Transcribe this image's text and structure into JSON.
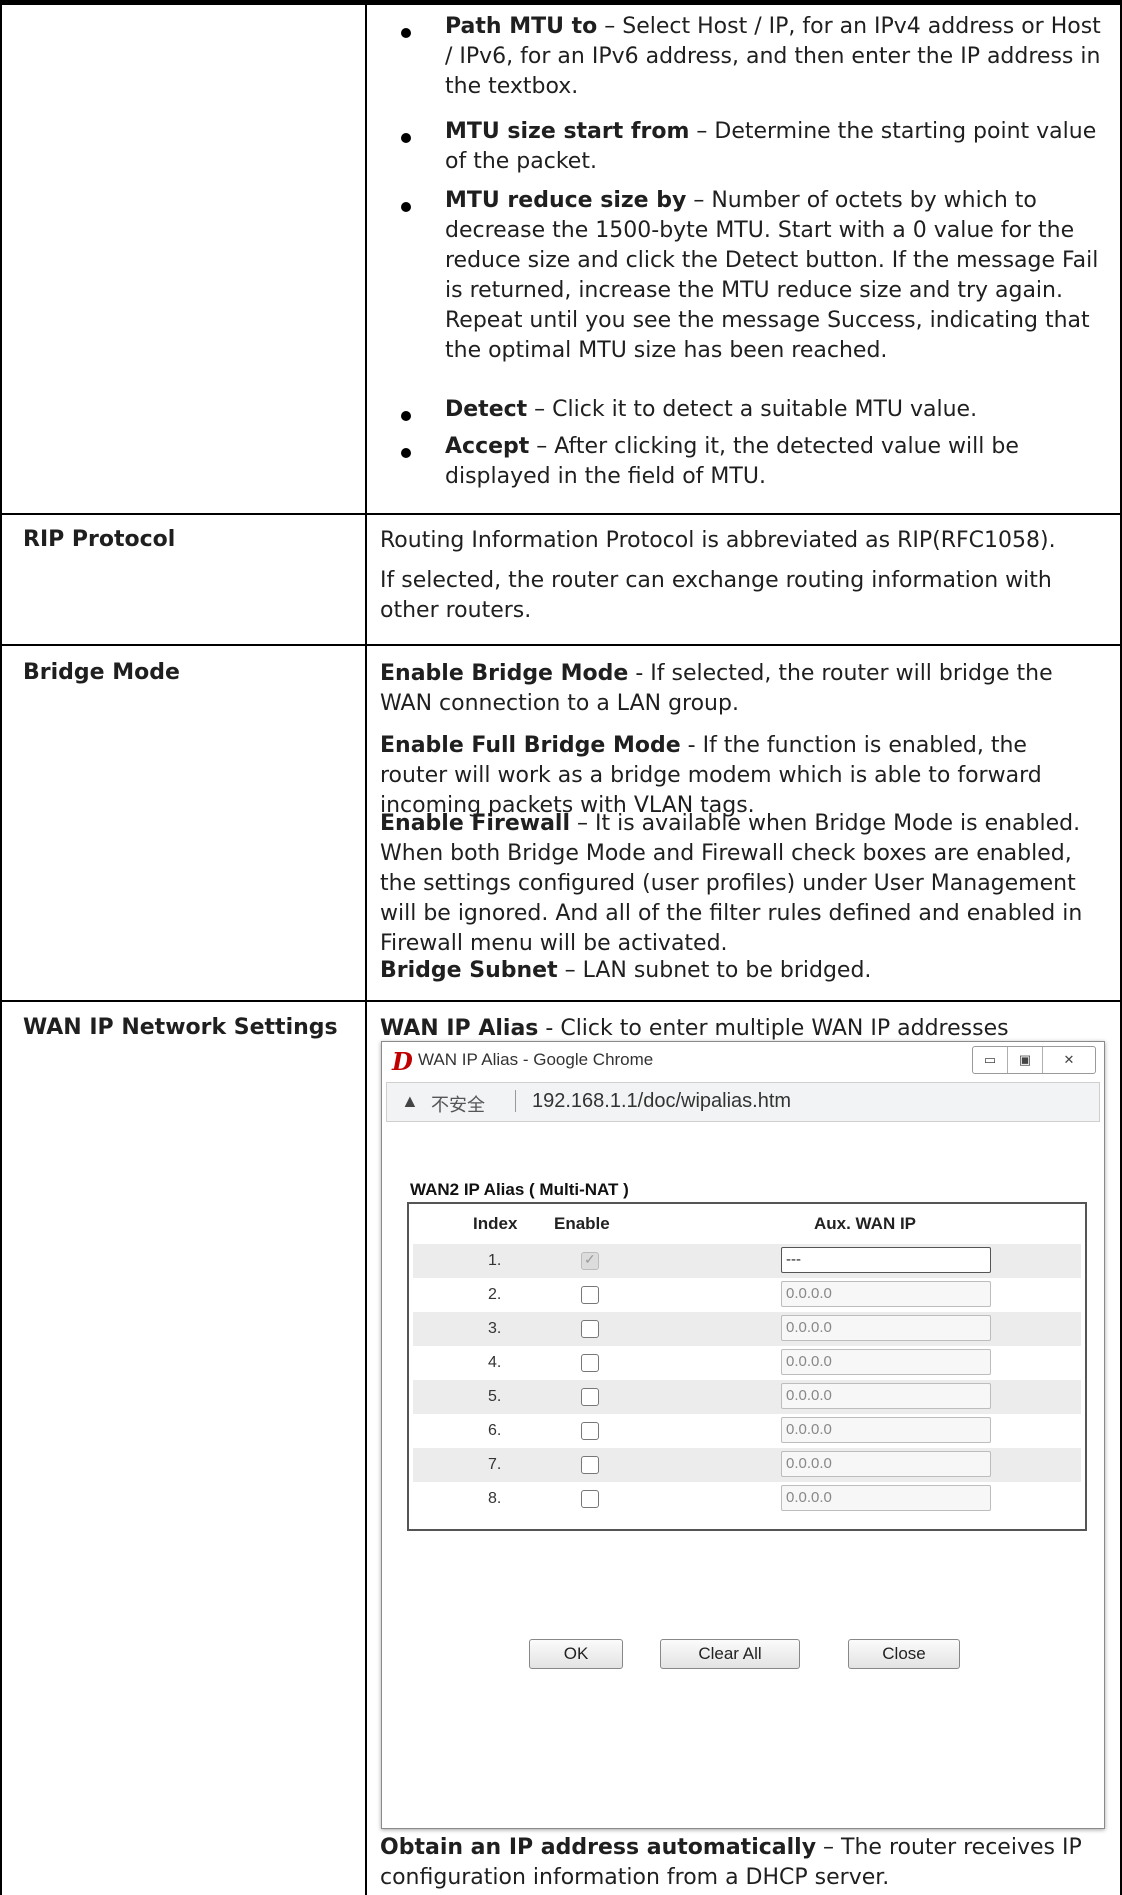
{
  "bullets": [
    {
      "term": "Path MTU to",
      "desc": " – Select Host / IP, for an IPv4 address or Host / IPv6, for an IPv6 address, and then enter the IP address in the textbox."
    },
    {
      "term": "MTU size start from",
      "desc": " – Determine the starting point value of the packet."
    },
    {
      "term": "MTU reduce size by",
      "desc": " – Number of octets by which to decrease the 1500-byte MTU. Start with a 0 value for the reduce size and click the Detect button. If the message Fail is returned, increase the MTU reduce size and try again. Repeat until you see the message Success, indicating that the optimal MTU size has been reached."
    },
    {
      "term": "Detect",
      "desc": " – Click it to detect a suitable MTU value."
    },
    {
      "term": "Accept",
      "desc": " – After clicking it, the detected value will be displayed in the field of MTU."
    }
  ],
  "rip": {
    "label": "RIP Protocol",
    "p1": "Routing Information Protocol is abbreviated as RIP(RFC1058).",
    "p2": "If selected, the router can exchange routing information with other routers."
  },
  "bridge": {
    "label": "Bridge Mode",
    "items": [
      {
        "term": "Enable Bridge Mode",
        "desc": " - If selected, the router will bridge the WAN connection to a LAN group."
      },
      {
        "term": "Enable Full Bridge Mode",
        "desc": " - If the function is enabled, the router will work as a bridge modem which is able to forward incoming packets with VLAN tags."
      },
      {
        "term": "Enable Firewall",
        "desc": " – It is available when Bridge Mode is enabled. When both Bridge Mode and Firewall check boxes are enabled, the settings configured (user profiles) under User Management will be ignored. And all of the filter rules defined and enabled in Firewall menu will be activated."
      },
      {
        "term": "Bridge Subnet",
        "desc": " – LAN subnet to be bridged."
      }
    ]
  },
  "wan": {
    "label": "WAN IP Network Settings",
    "alias_term": "WAN IP Alias",
    "alias_desc": " - Click to enter multiple WAN IP addresses assigned by your ISP.",
    "obtain_term": "Obtain an IP address automatically",
    "obtain_desc": " – The router receives IP configuration information from a DHCP server."
  },
  "popup": {
    "logo": "D",
    "window_title": "WAN IP Alias - Google Chrome",
    "win_minimize": "▭",
    "win_maximize": "▣",
    "win_close": "✕",
    "warning_icon": "▲",
    "insecure": "不安全",
    "url": "192.168.1.1/doc/wipalias.htm",
    "table_title": "WAN2  IP Alias ( Multi-NAT )",
    "headers": {
      "index": "Index",
      "enable": "Enable",
      "aux": "Aux. WAN IP"
    },
    "rows": [
      {
        "index": "1.",
        "enabled": true,
        "ip": "---"
      },
      {
        "index": "2.",
        "enabled": false,
        "ip": "0.0.0.0"
      },
      {
        "index": "3.",
        "enabled": false,
        "ip": "0.0.0.0"
      },
      {
        "index": "4.",
        "enabled": false,
        "ip": "0.0.0.0"
      },
      {
        "index": "5.",
        "enabled": false,
        "ip": "0.0.0.0"
      },
      {
        "index": "6.",
        "enabled": false,
        "ip": "0.0.0.0"
      },
      {
        "index": "7.",
        "enabled": false,
        "ip": "0.0.0.0"
      },
      {
        "index": "8.",
        "enabled": false,
        "ip": "0.0.0.0"
      }
    ],
    "buttons": {
      "ok": "OK",
      "clear": "Clear All",
      "close": "Close"
    }
  }
}
